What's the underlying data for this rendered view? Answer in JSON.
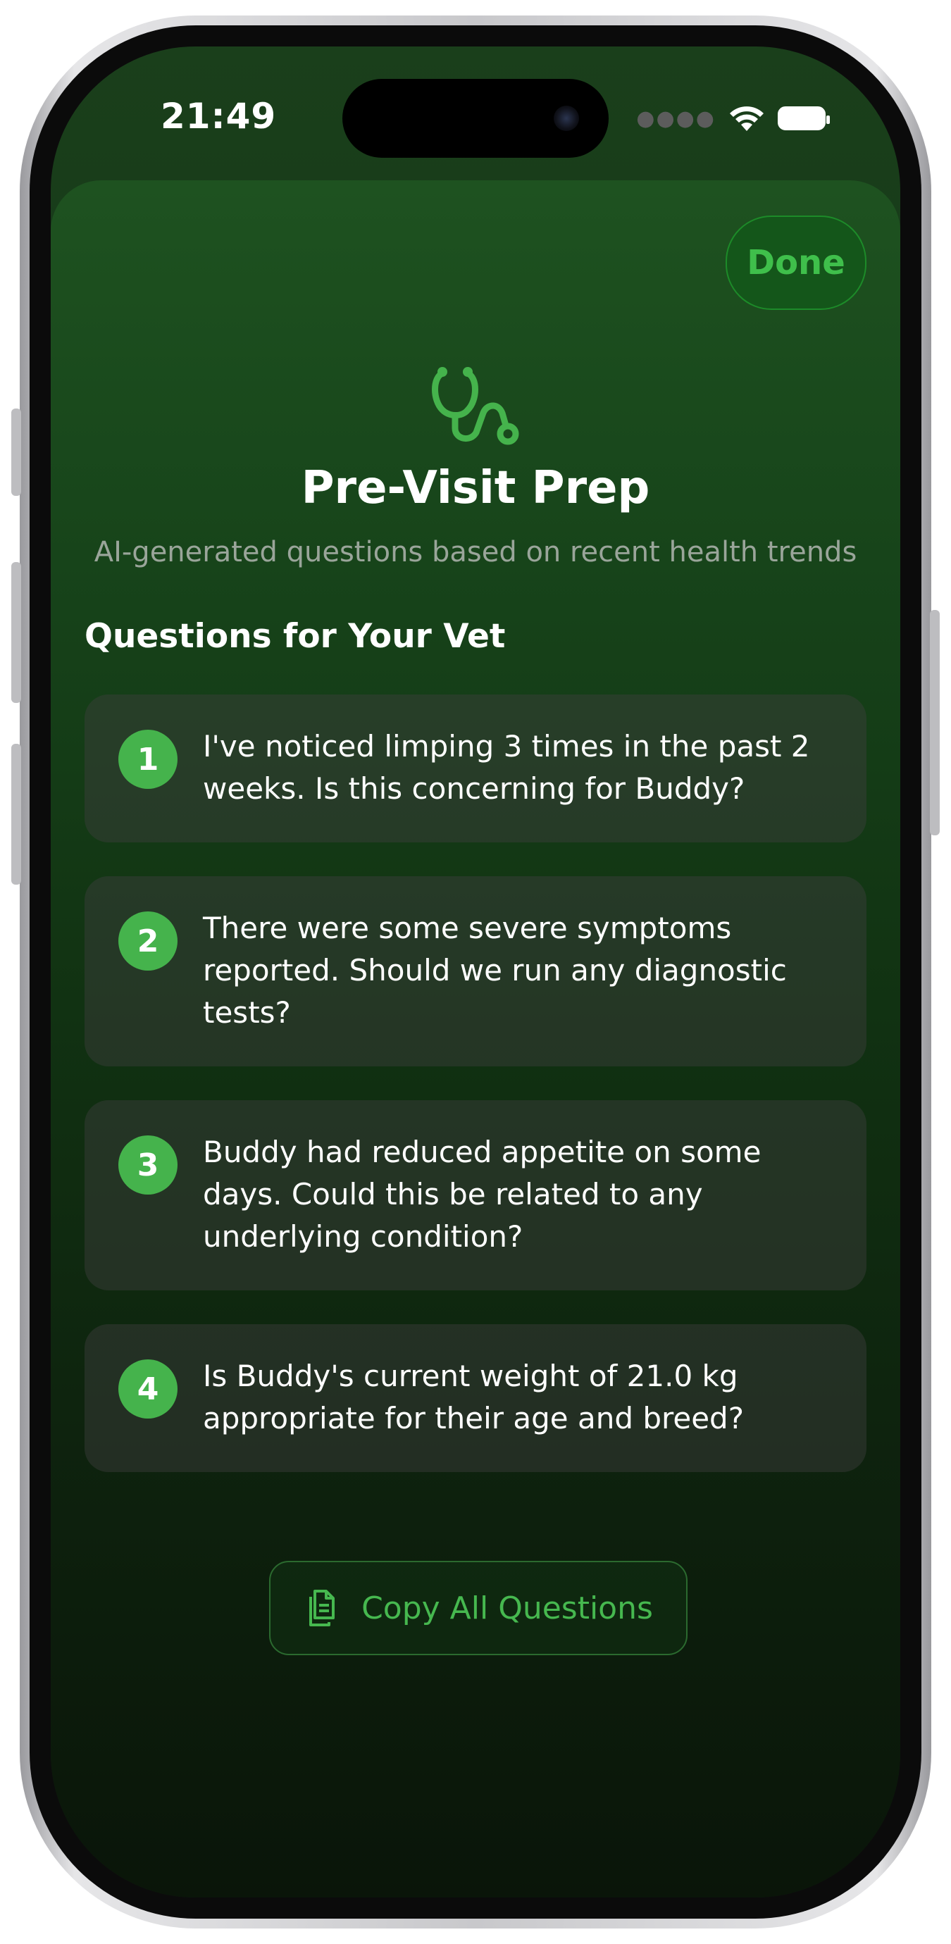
{
  "status_bar": {
    "time": "21:49"
  },
  "sheet": {
    "done_label": "Done",
    "title": "Pre-Visit Prep",
    "subtitle": "AI-generated questions based on recent health trends",
    "section_heading": "Questions for Your Vet",
    "questions": [
      {
        "number": "1",
        "text": "I've noticed limping 3 times in the past 2 weeks. Is this concerning for Buddy?"
      },
      {
        "number": "2",
        "text": "There were some severe symptoms reported. Should we run any diagnostic tests?"
      },
      {
        "number": "3",
        "text": "Buddy had reduced appetite on some days. Could this be related to any underlying condition?"
      },
      {
        "number": "4",
        "text": "Is Buddy's current weight of 21.0 kg appropriate for their age and breed?"
      }
    ],
    "copy_all_label": "Copy All Questions"
  },
  "icons": [
    "stethoscope-icon",
    "wifi-icon",
    "battery-icon",
    "copy-icon"
  ],
  "colors": {
    "accent": "#45b34c",
    "background": "#123315"
  }
}
